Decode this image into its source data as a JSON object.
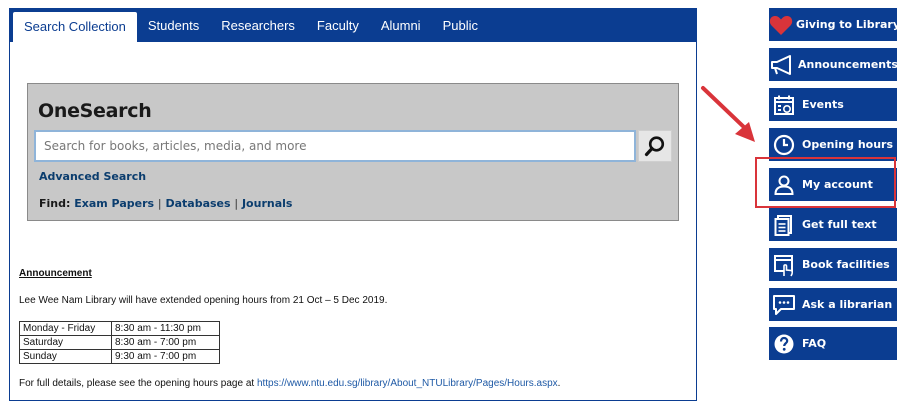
{
  "tabs": [
    {
      "label": "Search Collection",
      "active": true
    },
    {
      "label": "Students",
      "active": false
    },
    {
      "label": "Researchers",
      "active": false
    },
    {
      "label": "Faculty",
      "active": false
    },
    {
      "label": "Alumni",
      "active": false
    },
    {
      "label": "Public",
      "active": false
    }
  ],
  "search": {
    "brand": "OneSearch",
    "placeholder": "Search for books, articles, media, and more",
    "value": "",
    "advanced_label": "Advanced Search",
    "find_label": "Find:",
    "find_links": [
      "Exam Papers",
      "Databases",
      "Journals"
    ],
    "find_separator": "|"
  },
  "announcement": {
    "title": "Announcement",
    "text": "Lee Wee Nam Library will have extended opening hours from 21 Oct – 5 Dec 2019.",
    "hours": [
      {
        "day": "Monday - Friday",
        "time": "8:30 am - 11:30 pm"
      },
      {
        "day": "Saturday",
        "time": "8:30 am - 7:00 pm"
      },
      {
        "day": "Sunday",
        "time": "9:30 am - 7:00 pm"
      }
    ],
    "details_prefix": "For full details, please see the opening hours page at ",
    "details_url": "https://www.ntu.edu.sg/library/About_NTULibrary/Pages/Hours.aspx",
    "details_suffix": "."
  },
  "sidebar": [
    {
      "label": "Giving to Library",
      "icon": "heart-icon"
    },
    {
      "label": "Announcements",
      "icon": "megaphone-icon"
    },
    {
      "label": "Events",
      "icon": "calendar-icon"
    },
    {
      "label": "Opening hours",
      "icon": "clock-icon"
    },
    {
      "label": "My account",
      "icon": "user-icon",
      "highlighted": true
    },
    {
      "label": "Get full text",
      "icon": "document-icon"
    },
    {
      "label": "Book facilities",
      "icon": "booking-icon"
    },
    {
      "label": "Ask a librarian",
      "icon": "chat-icon"
    },
    {
      "label": "FAQ",
      "icon": "question-icon"
    }
  ],
  "colors": {
    "brand_blue": "#0b3d91",
    "highlight_red": "#d9343a",
    "heart_red": "#d9343a",
    "search_panel_grey": "#c8c8c8"
  }
}
